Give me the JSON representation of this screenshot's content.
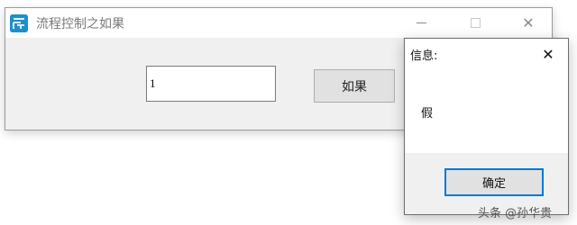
{
  "main_window": {
    "title": "流程控制之如果",
    "icon": "app-logo-icon",
    "controls": {
      "minimize": "minimize-icon",
      "maximize": "maximize-icon",
      "close": "close-icon",
      "close_glyph": "✕"
    },
    "input": {
      "value": "1"
    },
    "if_button_label": "如果"
  },
  "message_box": {
    "title": "信息:",
    "close_glyph": "✕",
    "message": "假",
    "ok_label": "确定"
  },
  "watermark": "头条 @孙华贵",
  "colors": {
    "accent": "#0078d7",
    "app_icon": "#1c8fcf",
    "window_bg": "#f0f0f0",
    "button_bg": "#e1e1e1"
  }
}
